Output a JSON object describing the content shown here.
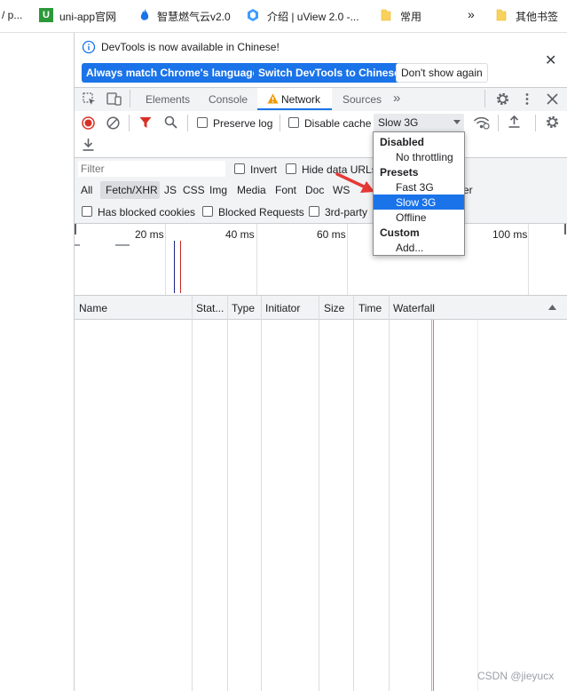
{
  "bookmarks": [
    {
      "label": "/ p..."
    },
    {
      "label": "uni-app官网"
    },
    {
      "label": "智慧燃气云v2.0"
    },
    {
      "label": "介绍 | uView 2.0 -..."
    },
    {
      "label": "常用"
    },
    {
      "label": "»"
    },
    {
      "label": "其他书签"
    }
  ],
  "infobar": {
    "message": "DevTools is now available in Chinese!",
    "btn_match": "Always match Chrome's language",
    "btn_switch": "Switch DevTools to Chinese",
    "btn_dont": "Don't show again",
    "close": "✕"
  },
  "tabs": {
    "elements": "Elements",
    "console": "Console",
    "network": "Network",
    "sources": "Sources",
    "more": "»"
  },
  "toolbar": {
    "preserve_log": "Preserve log",
    "disable_cache": "Disable cache",
    "throttle_value": "Slow 3G"
  },
  "filter": {
    "placeholder": "Filter",
    "invert": "Invert",
    "hide_data_urls": "Hide data URLs",
    "types": [
      "All",
      "Fetch/XHR",
      "JS",
      "CSS",
      "Img",
      "Media",
      "Font",
      "Doc",
      "WS"
    ],
    "types_tail": "er",
    "blocked_cookies": "Has blocked cookies",
    "blocked_requests": "Blocked Requests",
    "third_party": "3rd-party"
  },
  "overview": {
    "ticks": [
      "20 ms",
      "40 ms",
      "60 ms",
      "100 ms"
    ]
  },
  "table": {
    "columns": [
      "Name",
      "Stat...",
      "Type",
      "Initiator",
      "Size",
      "Time",
      "Waterfall"
    ]
  },
  "menu": {
    "disabled_header": "Disabled",
    "no_throttling": "No throttling",
    "presets_header": "Presets",
    "fast3g": "Fast 3G",
    "slow3g": "Slow 3G",
    "offline": "Offline",
    "custom_header": "Custom",
    "add": "Add..."
  },
  "watermark": "CSDN @jieyucx",
  "colors": {
    "accent": "#1a73e8",
    "network_warning": "#f29900",
    "record_red": "#d93025",
    "filter_red": "#d93025",
    "arrow_red": "#e53935"
  }
}
